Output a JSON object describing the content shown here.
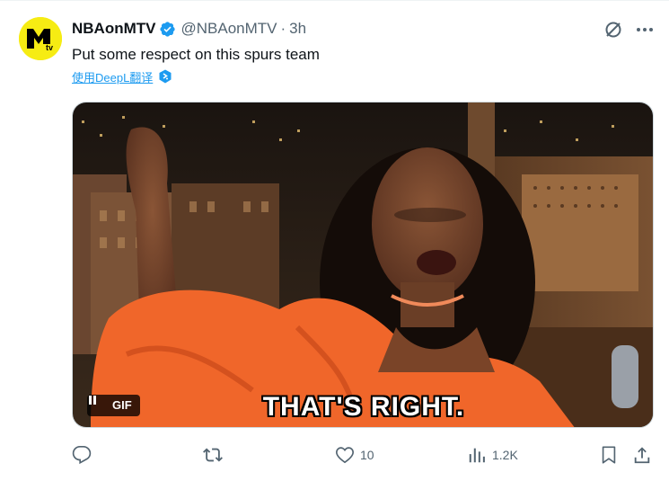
{
  "author": {
    "name": "NBAonMTV",
    "handle": "@NBAonMTV",
    "separator": "·",
    "time": "3h",
    "avatar_icon": "mtv-logo-icon",
    "avatar_color": "#f6ec13",
    "verified_color": "#1d9bf0"
  },
  "tweet": {
    "text": "Put some respect on this spurs team",
    "translate_label": "使用DeepL翻译",
    "link_color": "#1d9bf0"
  },
  "media": {
    "gif_label": "GIF",
    "caption": "THAT'S RIGHT.",
    "pause_icon": "pause-icon"
  },
  "actions": {
    "reply_count": "",
    "retweet_count": "",
    "like_count": "10",
    "views_count": "1.2K",
    "icons": [
      "reply-icon",
      "retweet-icon",
      "like-icon",
      "views-icon",
      "bookmark-icon",
      "share-icon"
    ]
  },
  "colors": {
    "text_primary": "#0f1419",
    "text_secondary": "#536471",
    "dress_orange": "#f0662a"
  }
}
